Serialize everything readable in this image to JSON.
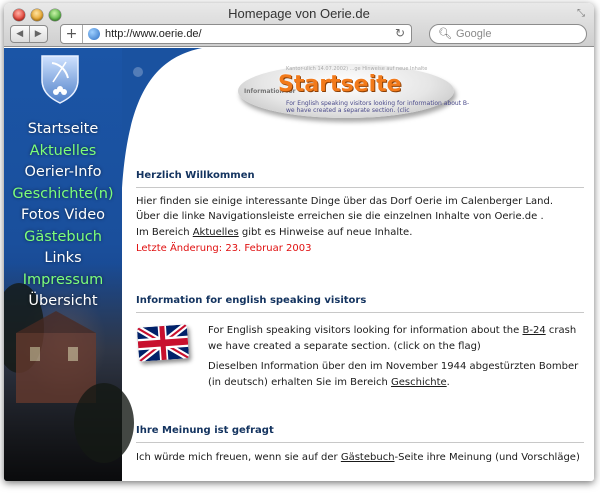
{
  "window": {
    "title": "Homepage von Oerie.de"
  },
  "toolbar": {
    "url": "http://www.oerie.de/",
    "search_placeholder": "Google",
    "back_glyph": "◀",
    "forward_glyph": "▶",
    "add_glyph": "+",
    "reload_glyph": "↻",
    "search_glyph": "🔍︎",
    "resize_glyph": "⤡"
  },
  "sidebar": {
    "items": [
      {
        "label": "Startseite",
        "color": "#ffffff"
      },
      {
        "label": "Aktuelles",
        "color": "#7dff7a"
      },
      {
        "label": "Oerier-Info",
        "color": "#ffffff"
      },
      {
        "label": "Geschichte(n)",
        "color": "#7dff7a"
      },
      {
        "label": "Fotos  Video",
        "color": "#ffffff"
      },
      {
        "label": "Gästebuch",
        "color": "#7dff7a"
      },
      {
        "label": "Links",
        "color": "#ffffff"
      },
      {
        "label": "Impressum",
        "color": "#7dff7a"
      },
      {
        "label": "Übersicht",
        "color": "#ffffff"
      }
    ]
  },
  "logo": {
    "title": "Startseite",
    "info_label": "Information for",
    "line1": "For English speaking visitors looking for information about B-",
    "line2": "we have created a separate section. (clic",
    "faded_top": "Kantor-ulich 14.07.2002)  ...ge Hinweise auf neue Inhalte"
  },
  "sections": {
    "welcome": {
      "heading": "Herzlich Willkommen",
      "line1": "Hier finden sie einige interessante Dinge über das Dorf Oerie im Calenberger Land.",
      "line2": "Über die linke Navigationsleiste erreichen sie die einzelnen Inhalte von Oerie.de .",
      "line3_pre": "Im Bereich ",
      "line3_link": "Aktuelles",
      "line3_post": " gibt es Hinweise auf neue Inhalte.",
      "last_change": "Letzte Änderung: 23. Februar 2003"
    },
    "english": {
      "heading": "Information for english speaking visitors",
      "p1_pre": "For English speaking visitors looking for information about the ",
      "p1_link": "B-24",
      "p1_post": " crash",
      "p1_line2": "we have created a separate section. (click on the flag)",
      "p2_line1": "Dieselben Information über den im November 1944 abgestürzten Bomber",
      "p2_pre": "(in deutsch) erhalten Sie im Bereich ",
      "p2_link": "Geschichte",
      "p2_post": "."
    },
    "opinion": {
      "heading": "Ihre Meinung ist gefragt",
      "line1_pre": "Ich würde mich freuen, wenn sie auf der ",
      "line1_link": "Gästebuch",
      "line1_post": "-Seite ihre Meinung (und Vorschläge)"
    }
  },
  "colors": {
    "sidebar_blue": "#1a4f9c",
    "nav_green": "#7dff7a",
    "heading_navy": "#13335f",
    "last_change_red": "#e01010",
    "logo_orange": "#f27a1a"
  }
}
